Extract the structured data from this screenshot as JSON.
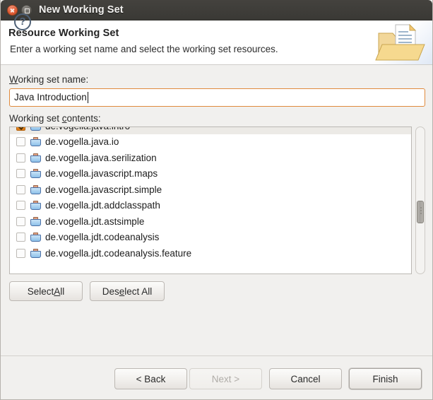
{
  "window": {
    "title": "New Working Set",
    "close_icon": "close-icon",
    "maximize_icon": "maximize-icon"
  },
  "banner": {
    "title": "Resource Working Set",
    "description": "Enter a working set name and select the working set resources.",
    "icon": "folder-with-document-icon"
  },
  "form": {
    "name_label_pre": "",
    "name_label_mnemonic": "W",
    "name_label_post": "orking set name:",
    "name_value": "Java Introduction",
    "contents_label_pre": "Working set ",
    "contents_label_mnemonic": "c",
    "contents_label_post": "ontents:"
  },
  "list": {
    "items": [
      {
        "label": "de.vogella.java.intro",
        "checked": true,
        "selected": true
      },
      {
        "label": "de.vogella.java.io",
        "checked": false,
        "selected": false
      },
      {
        "label": "de.vogella.java.serilization",
        "checked": false,
        "selected": false
      },
      {
        "label": "de.vogella.javascript.maps",
        "checked": false,
        "selected": false
      },
      {
        "label": "de.vogella.javascript.simple",
        "checked": false,
        "selected": false
      },
      {
        "label": "de.vogella.jdt.addclasspath",
        "checked": false,
        "selected": false
      },
      {
        "label": "de.vogella.jdt.astsimple",
        "checked": false,
        "selected": false
      },
      {
        "label": "de.vogella.jdt.codeanalysis",
        "checked": false,
        "selected": false
      },
      {
        "label": "de.vogella.jdt.codeanalysis.feature",
        "checked": false,
        "selected": false
      }
    ],
    "folder_icon": "folder-icon",
    "checkbox_checked_color": "#dd7a16"
  },
  "select_buttons": {
    "select_all_pre": "Select ",
    "select_all_mnemonic": "A",
    "select_all_post": "ll",
    "deselect_all_pre": "Des",
    "deselect_all_mnemonic": "e",
    "deselect_all_post": "lect All"
  },
  "footer": {
    "help_icon": "help-icon",
    "help_glyph": "?",
    "back_label": "< Back",
    "next_label": "Next >",
    "next_enabled": false,
    "cancel_label": "Cancel",
    "finish_label": "Finish"
  }
}
